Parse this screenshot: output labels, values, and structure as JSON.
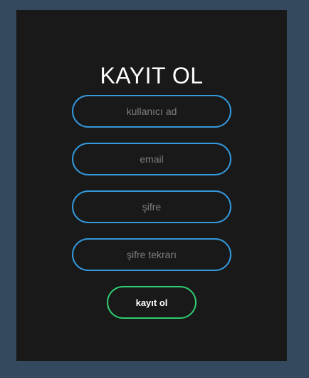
{
  "form": {
    "title": "KAYIT OL",
    "fields": [
      {
        "placeholder": "kullanıcı ad",
        "value": ""
      },
      {
        "placeholder": "email",
        "value": ""
      },
      {
        "placeholder": "şifre",
        "value": ""
      },
      {
        "placeholder": "şifre tekrarı",
        "value": ""
      }
    ],
    "submit_label": "kayıt ol"
  },
  "colors": {
    "page_background": "#34495e",
    "card_background": "#191919",
    "input_border": "#3498db",
    "button_border": "#2ecc71",
    "title_text": "#ffffff"
  }
}
